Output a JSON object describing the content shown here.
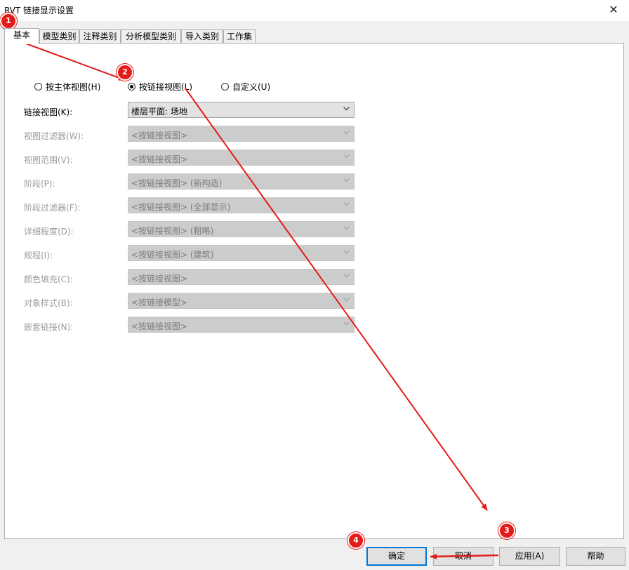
{
  "window": {
    "title": "RVT 链接显示设置",
    "close_glyph": "✕"
  },
  "tabs": [
    "基本",
    "模型类别",
    "注释类别",
    "分析模型类别",
    "导入类别",
    "工作集"
  ],
  "radios": [
    {
      "label": "按主体视图(H)",
      "checked": false
    },
    {
      "label": "按链接视图(L)",
      "checked": true
    },
    {
      "label": "自定义(U)",
      "checked": false
    }
  ],
  "fields": [
    {
      "label": "链接视图(K):",
      "value": "楼层平面: 场地",
      "enabled": true
    },
    {
      "label": "视图过滤器(W):",
      "value": "<按链接视图>",
      "enabled": false
    },
    {
      "label": "视图范围(V):",
      "value": "<按链接视图>",
      "enabled": false
    },
    {
      "label": "阶段(P):",
      "value": "<按链接视图> (新构造)",
      "enabled": false
    },
    {
      "label": "阶段过滤器(F):",
      "value": "<按链接视图> (全部显示)",
      "enabled": false
    },
    {
      "label": "详细程度(D):",
      "value": "<按链接视图> (粗略)",
      "enabled": false
    },
    {
      "label": "规程(I):",
      "value": "<按链接视图> (建筑)",
      "enabled": false
    },
    {
      "label": "颜色填充(C):",
      "value": "<按链接视图>",
      "enabled": false
    },
    {
      "label": "对象样式(B):",
      "value": "<按链接模型>",
      "enabled": false
    },
    {
      "label": "嵌套链接(N):",
      "value": "<按链接视图>",
      "enabled": false
    }
  ],
  "buttons": {
    "ok": "确定",
    "cancel": "取消",
    "apply": "应用(A)",
    "help": "帮助"
  },
  "annotations": {
    "badges": [
      "1",
      "2",
      "3",
      "4"
    ],
    "color": "#e41b1b"
  }
}
